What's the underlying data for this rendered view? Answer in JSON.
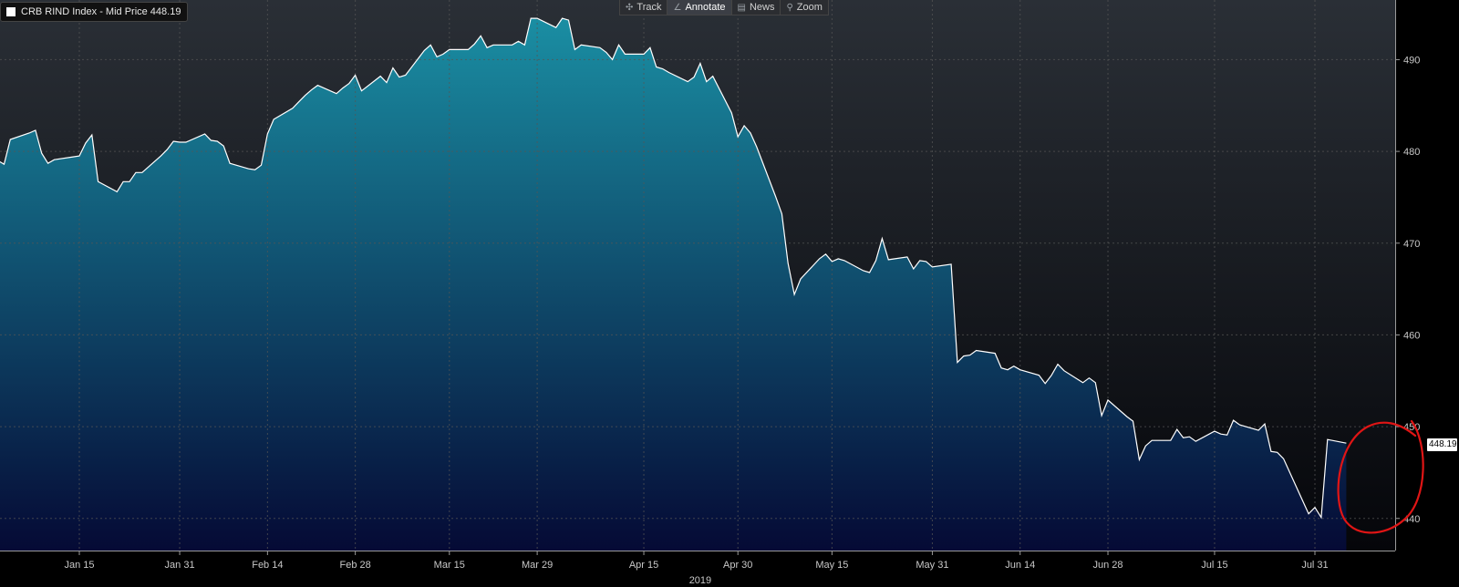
{
  "legend": {
    "text": "CRB RIND Index - Mid Price 448.19",
    "swatch_color": "#ffffff"
  },
  "toolbar": {
    "items": [
      {
        "label": "Track",
        "icon": "crosshair-icon",
        "glyph": "✣"
      },
      {
        "label": "Annotate",
        "icon": "pencil-icon",
        "glyph": "∠",
        "active": true
      },
      {
        "label": "News",
        "icon": "news-icon",
        "glyph": "▤"
      },
      {
        "label": "Zoom",
        "icon": "magnifier-icon",
        "glyph": "⚲"
      }
    ]
  },
  "last_price_label": "448.19",
  "colors": {
    "background_top": "#2a2f36",
    "background_bottom": "#05060a",
    "fill_top": "#1a8ea3",
    "fill_bottom": "#050a35",
    "line": "#ffffff",
    "grid": "#555555",
    "annotation": "#e01515"
  },
  "annotation": {
    "type": "hand-drawn circle",
    "target": "last ~6 data points (early August dip and rebound)"
  },
  "chart_data": {
    "type": "area",
    "title": "",
    "xlabel": "2019",
    "ylabel": "",
    "ylim": [
      436.5,
      496.5
    ],
    "y_ticks": [
      440,
      450,
      460,
      470,
      480,
      490
    ],
    "y_axis_position": "right",
    "x_tick_labels": [
      "Jan 15",
      "Jan 31",
      "Feb 14",
      "Feb 28",
      "Mar 15",
      "Mar 29",
      "Apr 15",
      "Apr 30",
      "May 15",
      "May 31",
      "Jun 14",
      "Jun 28",
      "Jul 15",
      "Jul 31"
    ],
    "x_tick_dates": [
      "2019-01-15",
      "2019-01-31",
      "2019-02-14",
      "2019-02-28",
      "2019-03-15",
      "2019-03-29",
      "2019-04-15",
      "2019-04-30",
      "2019-05-15",
      "2019-05-31",
      "2019-06-14",
      "2019-06-28",
      "2019-07-15",
      "2019-07-31"
    ],
    "grid": true,
    "series": [
      {
        "name": "CRB RIND Index - Mid Price",
        "points": [
          [
            "2019-01-02",
            479.0
          ],
          [
            "2019-01-03",
            478.6
          ],
          [
            "2019-01-04",
            481.3
          ],
          [
            "2019-01-07",
            482.0
          ],
          [
            "2019-01-08",
            482.3
          ],
          [
            "2019-01-09",
            479.8
          ],
          [
            "2019-01-10",
            478.7
          ],
          [
            "2019-01-11",
            479.1
          ],
          [
            "2019-01-14",
            479.4
          ],
          [
            "2019-01-15",
            479.5
          ],
          [
            "2019-01-16",
            480.9
          ],
          [
            "2019-01-17",
            481.8
          ],
          [
            "2019-01-18",
            476.7
          ],
          [
            "2019-01-21",
            475.6
          ],
          [
            "2019-01-22",
            476.7
          ],
          [
            "2019-01-23",
            476.7
          ],
          [
            "2019-01-24",
            477.7
          ],
          [
            "2019-01-25",
            477.7
          ],
          [
            "2019-01-28",
            479.5
          ],
          [
            "2019-01-29",
            480.2
          ],
          [
            "2019-01-30",
            481.1
          ],
          [
            "2019-01-31",
            481.0
          ],
          [
            "2019-02-01",
            481.0
          ],
          [
            "2019-02-04",
            481.9
          ],
          [
            "2019-02-05",
            481.2
          ],
          [
            "2019-02-06",
            481.1
          ],
          [
            "2019-02-07",
            480.6
          ],
          [
            "2019-02-08",
            478.7
          ],
          [
            "2019-02-11",
            478.1
          ],
          [
            "2019-02-12",
            478.0
          ],
          [
            "2019-02-13",
            478.5
          ],
          [
            "2019-02-14",
            481.9
          ],
          [
            "2019-02-15",
            483.5
          ],
          [
            "2019-02-18",
            484.7
          ],
          [
            "2019-02-19",
            485.4
          ],
          [
            "2019-02-20",
            486.1
          ],
          [
            "2019-02-21",
            486.7
          ],
          [
            "2019-02-22",
            487.2
          ],
          [
            "2019-02-25",
            486.3
          ],
          [
            "2019-02-26",
            486.9
          ],
          [
            "2019-02-27",
            487.4
          ],
          [
            "2019-02-28",
            488.3
          ],
          [
            "2019-03-01",
            486.6
          ],
          [
            "2019-03-04",
            488.2
          ],
          [
            "2019-03-05",
            487.5
          ],
          [
            "2019-03-06",
            489.1
          ],
          [
            "2019-03-07",
            488.1
          ],
          [
            "2019-03-08",
            488.3
          ],
          [
            "2019-03-11",
            491.0
          ],
          [
            "2019-03-12",
            491.6
          ],
          [
            "2019-03-13",
            490.3
          ],
          [
            "2019-03-14",
            490.6
          ],
          [
            "2019-03-15",
            491.1
          ],
          [
            "2019-03-18",
            491.1
          ],
          [
            "2019-03-19",
            491.7
          ],
          [
            "2019-03-20",
            492.6
          ],
          [
            "2019-03-21",
            491.3
          ],
          [
            "2019-03-22",
            491.6
          ],
          [
            "2019-03-25",
            491.6
          ],
          [
            "2019-03-26",
            492.0
          ],
          [
            "2019-03-27",
            491.6
          ],
          [
            "2019-03-28",
            494.5
          ],
          [
            "2019-03-29",
            494.5
          ],
          [
            "2019-04-01",
            493.5
          ],
          [
            "2019-04-02",
            494.5
          ],
          [
            "2019-04-03",
            494.3
          ],
          [
            "2019-04-04",
            491.1
          ],
          [
            "2019-04-05",
            491.6
          ],
          [
            "2019-04-08",
            491.3
          ],
          [
            "2019-04-09",
            490.8
          ],
          [
            "2019-04-10",
            490.0
          ],
          [
            "2019-04-11",
            491.6
          ],
          [
            "2019-04-12",
            490.6
          ],
          [
            "2019-04-15",
            490.6
          ],
          [
            "2019-04-16",
            491.3
          ],
          [
            "2019-04-17",
            489.2
          ],
          [
            "2019-04-18",
            489.0
          ],
          [
            "2019-04-19",
            488.6
          ],
          [
            "2019-04-22",
            487.6
          ],
          [
            "2019-04-23",
            488.1
          ],
          [
            "2019-04-24",
            489.6
          ],
          [
            "2019-04-25",
            487.6
          ],
          [
            "2019-04-26",
            488.2
          ],
          [
            "2019-04-29",
            484.2
          ],
          [
            "2019-04-30",
            481.6
          ],
          [
            "2019-05-01",
            482.8
          ],
          [
            "2019-05-02",
            482.0
          ],
          [
            "2019-05-03",
            480.5
          ],
          [
            "2019-05-06",
            475.1
          ],
          [
            "2019-05-07",
            473.2
          ],
          [
            "2019-05-08",
            467.8
          ],
          [
            "2019-05-09",
            464.4
          ],
          [
            "2019-05-10",
            466.1
          ],
          [
            "2019-05-13",
            468.3
          ],
          [
            "2019-05-14",
            468.8
          ],
          [
            "2019-05-15",
            468.0
          ],
          [
            "2019-05-16",
            468.3
          ],
          [
            "2019-05-17",
            468.1
          ],
          [
            "2019-05-20",
            467.0
          ],
          [
            "2019-05-21",
            466.8
          ],
          [
            "2019-05-22",
            468.1
          ],
          [
            "2019-05-23",
            470.5
          ],
          [
            "2019-05-24",
            468.2
          ],
          [
            "2019-05-27",
            468.5
          ],
          [
            "2019-05-28",
            467.2
          ],
          [
            "2019-05-29",
            468.1
          ],
          [
            "2019-05-30",
            468.0
          ],
          [
            "2019-05-31",
            467.4
          ],
          [
            "2019-06-03",
            467.7
          ],
          [
            "2019-06-04",
            457.0
          ],
          [
            "2019-06-05",
            457.7
          ],
          [
            "2019-06-06",
            457.8
          ],
          [
            "2019-06-07",
            458.3
          ],
          [
            "2019-06-10",
            458.0
          ],
          [
            "2019-06-11",
            456.4
          ],
          [
            "2019-06-12",
            456.2
          ],
          [
            "2019-06-13",
            456.6
          ],
          [
            "2019-06-14",
            456.2
          ],
          [
            "2019-06-17",
            455.6
          ],
          [
            "2019-06-18",
            454.7
          ],
          [
            "2019-06-19",
            455.6
          ],
          [
            "2019-06-20",
            456.8
          ],
          [
            "2019-06-21",
            456.1
          ],
          [
            "2019-06-24",
            454.8
          ],
          [
            "2019-06-25",
            455.3
          ],
          [
            "2019-06-26",
            454.8
          ],
          [
            "2019-06-27",
            451.2
          ],
          [
            "2019-06-28",
            452.9
          ],
          [
            "2019-07-01",
            451.1
          ],
          [
            "2019-07-02",
            450.6
          ],
          [
            "2019-07-03",
            446.4
          ],
          [
            "2019-07-04",
            447.9
          ],
          [
            "2019-07-05",
            448.5
          ],
          [
            "2019-07-08",
            448.5
          ],
          [
            "2019-07-09",
            449.7
          ],
          [
            "2019-07-10",
            448.8
          ],
          [
            "2019-07-11",
            448.9
          ],
          [
            "2019-07-12",
            448.4
          ],
          [
            "2019-07-15",
            449.5
          ],
          [
            "2019-07-16",
            449.2
          ],
          [
            "2019-07-17",
            449.1
          ],
          [
            "2019-07-18",
            450.7
          ],
          [
            "2019-07-19",
            450.2
          ],
          [
            "2019-07-22",
            449.6
          ],
          [
            "2019-07-23",
            450.3
          ],
          [
            "2019-07-24",
            447.3
          ],
          [
            "2019-07-25",
            447.2
          ],
          [
            "2019-07-26",
            446.5
          ],
          [
            "2019-07-29",
            442.0
          ],
          [
            "2019-07-30",
            440.5
          ],
          [
            "2019-07-31",
            441.2
          ],
          [
            "2019-08-01",
            440.1
          ],
          [
            "2019-08-02",
            448.6
          ],
          [
            "2019-08-05",
            448.2
          ]
        ]
      }
    ],
    "last_value": 448.19,
    "legend_position": "top-left"
  }
}
